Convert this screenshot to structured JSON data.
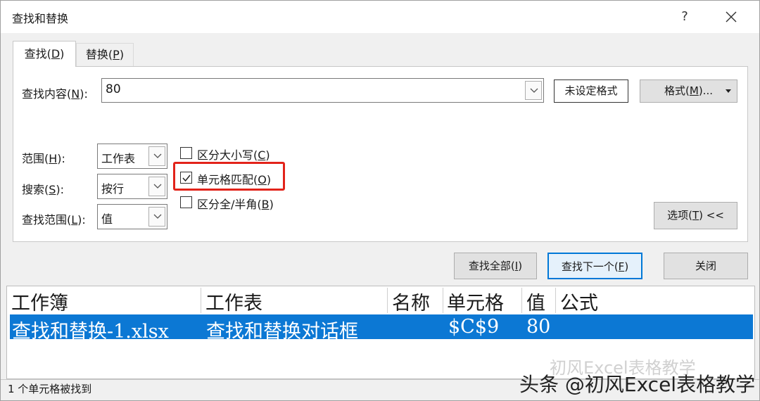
{
  "window": {
    "title": "查找和替换",
    "help": "?",
    "close": "×"
  },
  "tabs": {
    "find": {
      "label": "查找(",
      "key": "D",
      "end": ")"
    },
    "replace": {
      "label": "替换(",
      "key": "P",
      "end": ")"
    }
  },
  "find": {
    "label": "查找内容(",
    "key": "N",
    "end": "):",
    "value": "80",
    "format_preview": "未设定格式",
    "format_button": {
      "label": "格式(",
      "key": "M",
      "end": ")..."
    }
  },
  "options": {
    "within": {
      "label": "范围(",
      "key": "H",
      "end": "):",
      "value": "工作表"
    },
    "search": {
      "label": "搜索(",
      "key": "S",
      "end": "):",
      "value": "按行"
    },
    "look_in": {
      "label": "查找范围(",
      "key": "L",
      "end": "):",
      "value": "值"
    },
    "match_case": {
      "label": "区分大小写(",
      "key": "C",
      "end": ")",
      "checked": false
    },
    "match_entire": {
      "label": "单元格匹配(",
      "key": "O",
      "end": ")",
      "checked": true
    },
    "match_byte": {
      "label": "区分全/半角(",
      "key": "B",
      "end": ")",
      "checked": false
    },
    "options_button": {
      "label": "选项(",
      "key": "T",
      "end": ") <<"
    }
  },
  "buttons": {
    "find_all": {
      "label": "查找全部(",
      "key": "I",
      "end": ")"
    },
    "find_next": {
      "label": "查找下一个(",
      "key": "F",
      "end": ")"
    },
    "close": "关闭"
  },
  "results": {
    "columns": [
      "工作簿",
      "工作表",
      "名称",
      "单元格",
      "值",
      "公式"
    ],
    "rows": [
      {
        "book": "查找和替换-1.xlsx",
        "sheet": "查找和替换对话框",
        "name": "",
        "cell": "$C$9",
        "value": "80",
        "formula": ""
      }
    ]
  },
  "status": "1 个单元格被找到",
  "watermark": {
    "ghost": "初风Excel表格教学",
    "main": "头条 @初风Excel表格教学"
  },
  "colors": {
    "selection": "#0c78d4",
    "highlight_box": "#e2231a",
    "default_button_border": "#0078d7"
  }
}
